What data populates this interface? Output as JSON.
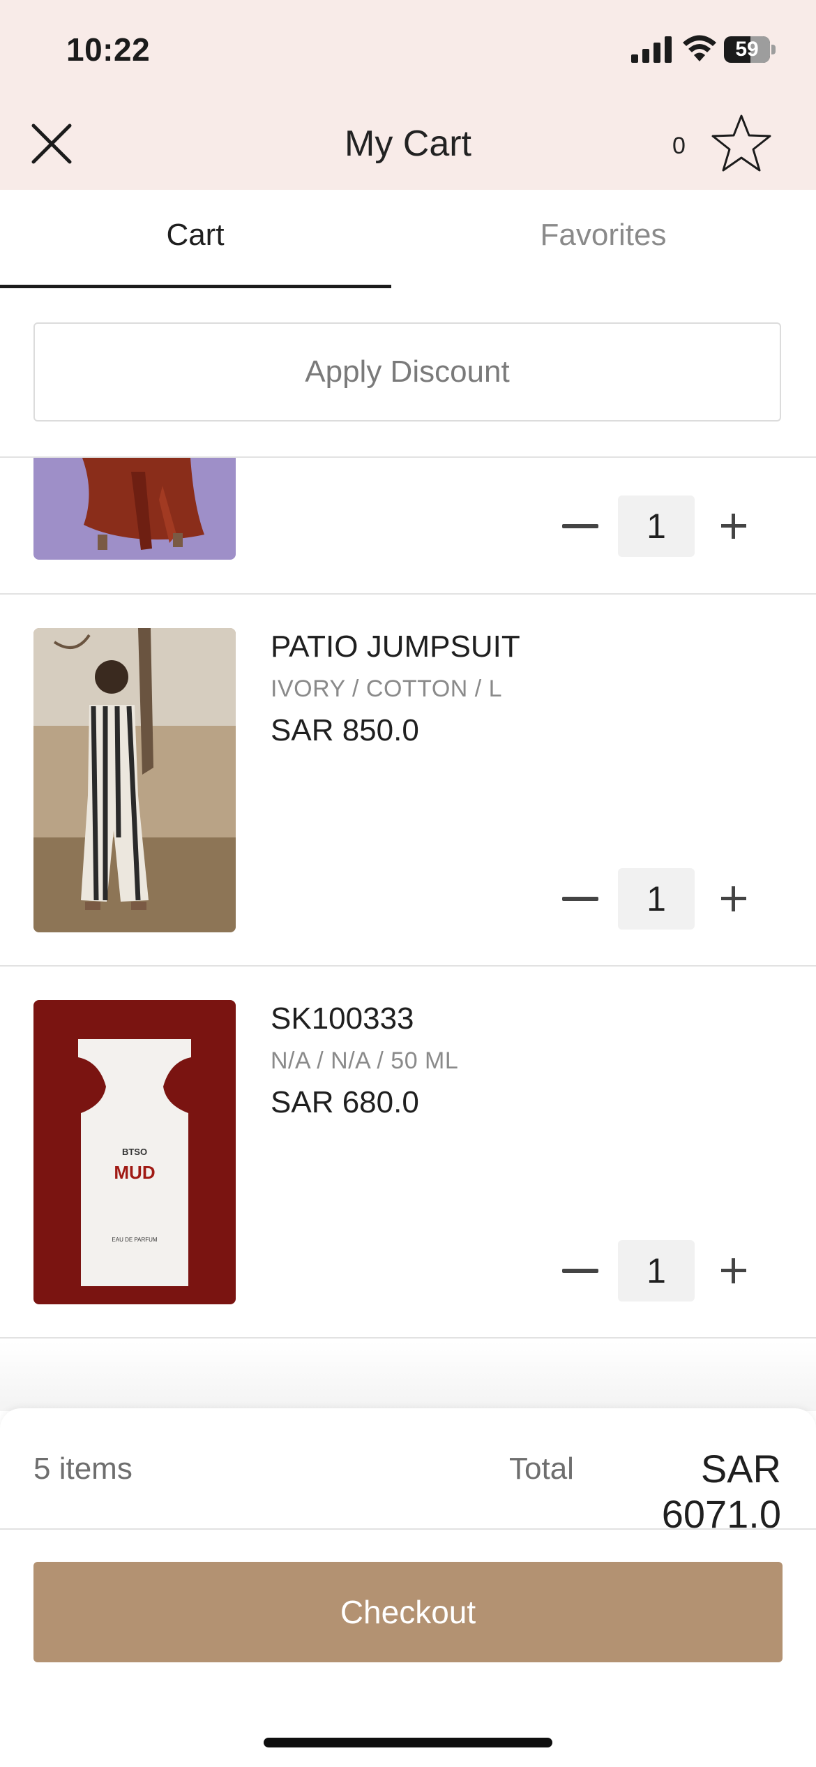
{
  "status_bar": {
    "time": "10:22",
    "battery": "59"
  },
  "header": {
    "title": "My Cart",
    "favorites_count": "0"
  },
  "tabs": [
    {
      "label": "Cart",
      "active": true
    },
    {
      "label": "Favorites",
      "active": false
    }
  ],
  "discount": {
    "label": "Apply Discount"
  },
  "cart_items": [
    {
      "name": "",
      "variant": "",
      "price": "",
      "quantity": "1"
    },
    {
      "name": "PATIO JUMPSUIT",
      "variant": "IVORY / COTTON / L",
      "price": "SAR 850.0",
      "quantity": "1"
    },
    {
      "name": "SK100333",
      "variant": "N/A / N/A / 50 ML",
      "price": "SAR 680.0",
      "quantity": "1",
      "image_text": {
        "brand": "BTSO",
        "product": "MUD",
        "type": "EAU DE PARFUM"
      }
    }
  ],
  "summary": {
    "items_count": "5 items",
    "total_label": "Total",
    "total_value": "SAR 6071.0"
  },
  "checkout": {
    "label": "Checkout"
  },
  "colors": {
    "header_bg": "#f8ebe8",
    "checkout_bg": "#b39272",
    "active_tab": "#1b1b1b",
    "inactive_tab": "#8a8a8a"
  }
}
